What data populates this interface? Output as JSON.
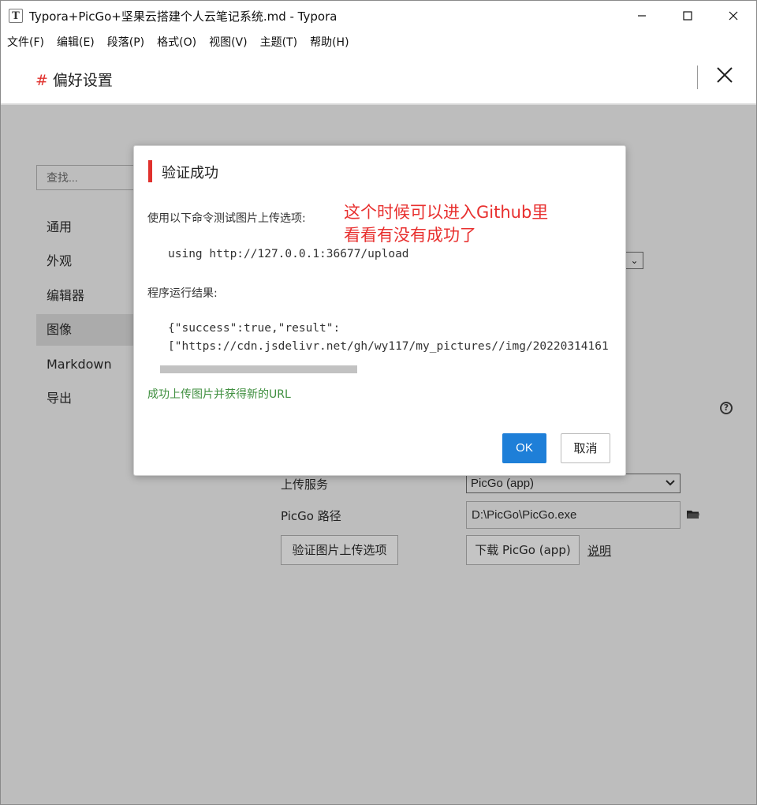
{
  "window": {
    "title": "Typora+PicGo+坚果云搭建个人云笔记系统.md - Typora",
    "app_icon_letter": "T",
    "minimize": "—",
    "maximize": "☐",
    "close": "✕"
  },
  "menubar": {
    "items": [
      "文件(F)",
      "编辑(E)",
      "段落(P)",
      "格式(O)",
      "视图(V)",
      "主题(T)",
      "帮助(H)"
    ]
  },
  "preferences": {
    "hash": "#",
    "title": "偏好设置",
    "close": "✕"
  },
  "sidebar": {
    "search_placeholder": "查找...",
    "items": [
      {
        "label": "通用"
      },
      {
        "label": "外观"
      },
      {
        "label": "编辑器"
      },
      {
        "label": "图像",
        "active": true
      },
      {
        "label": "Markdown"
      },
      {
        "label": "导出"
      }
    ]
  },
  "image_settings": {
    "collapsed_select_chevron": "⌄",
    "help_icon": "?",
    "upload_service_label": "上传服务",
    "upload_service_value": "PicGo (app)",
    "picgo_path_label": "PicGo 路径",
    "picgo_path_value": "D:\\PicGo\\PicGo.exe",
    "verify_button": "验证图片上传选项",
    "download_button": "下载 PicGo (app)",
    "help_link": "说明"
  },
  "dialog": {
    "title": "验证成功",
    "intro": "使用以下命令测试图片上传选项:",
    "command": "using http://127.0.0.1:36677/upload",
    "result_label": "程序运行结果:",
    "result_line1": "{\"success\":true,\"result\":",
    "result_line2": "[\"https://cdn.jsdelivr.net/gh/wy117/my_pictures//img/20220314161",
    "success_message": "成功上传图片并获得新的URL",
    "annotation_line1": "这个时候可以进入Github里",
    "annotation_line2": "看看有没有成功了",
    "ok": "OK",
    "cancel": "取消"
  },
  "colors": {
    "accent_red": "#e0312d",
    "ok_blue": "#1e7fd8",
    "success_green": "#3f8f3f",
    "overlay_gray": "#bdbdbd"
  }
}
